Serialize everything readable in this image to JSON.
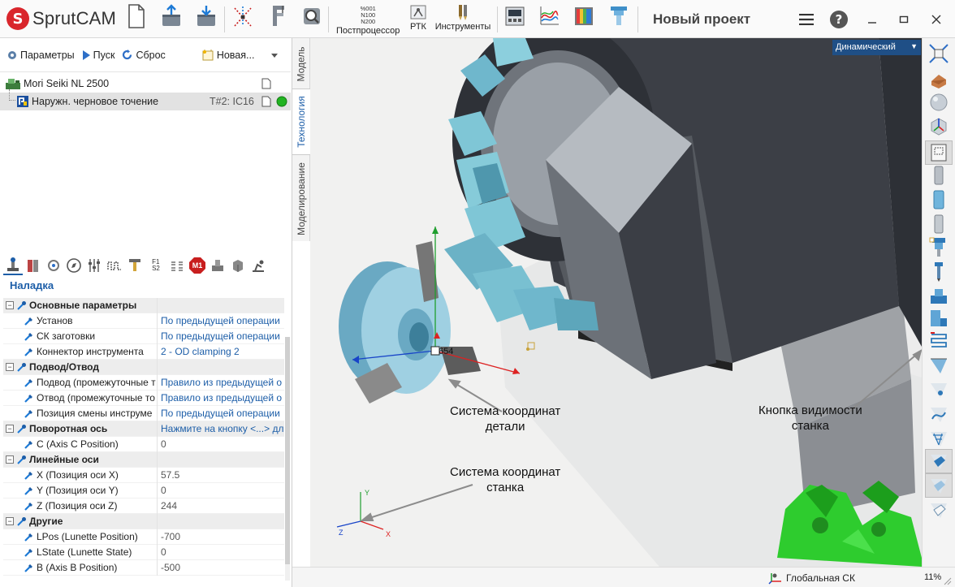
{
  "app": {
    "logo_letter": "S",
    "name": "SprutCAM",
    "project_title": "Новый проект"
  },
  "toolbar": {
    "postprocessor_label": "Постпроцессор",
    "rtk_label": "РТК",
    "tools_label": "Инструменты",
    "nc_codes": [
      "%001",
      "N100",
      "N200"
    ]
  },
  "left_toolbar": {
    "params_label": "Параметры",
    "run_label": "Пуск",
    "reset_label": "Сброс",
    "new_label": "Новая..."
  },
  "tree": {
    "machine": "Mori Seiki NL 2500",
    "operation": "Наружн. черновое точение",
    "operation_tool": "T#2: IC16"
  },
  "vertical_tabs": [
    "Модель",
    "Технология",
    "Моделирование"
  ],
  "setup": {
    "title": "Наладка",
    "m1_badge": "M1",
    "f1_label": "F1",
    "s2_label": "S2",
    "rows": [
      {
        "kind": "cat",
        "name": "Основные параметры",
        "value": ""
      },
      {
        "kind": "prop",
        "name": "Установ",
        "value": "По предыдущей операции",
        "link": true
      },
      {
        "kind": "prop",
        "name": "СК заготовки",
        "value": "По предыдущей операции",
        "link": true
      },
      {
        "kind": "prop",
        "name": "Коннектор инструмента",
        "value": "2 - OD clamping 2",
        "link": true
      },
      {
        "kind": "cat",
        "name": "Подвод/Отвод",
        "value": ""
      },
      {
        "kind": "prop",
        "name": "Подвод (промежуточные т",
        "value": "Правило из предыдущей о",
        "link": true
      },
      {
        "kind": "prop",
        "name": "Отвод (промежуточные то",
        "value": "Правило из предыдущей о",
        "link": true
      },
      {
        "kind": "prop",
        "name": "Позиция смены инструме",
        "value": "По предыдущей операции",
        "link": true
      },
      {
        "kind": "cat",
        "name": "Поворотная ось",
        "value": "Нажмите на кнопку <...> дл",
        "link": true
      },
      {
        "kind": "prop",
        "name": "C (Axis C Position)",
        "value": "0",
        "link": false
      },
      {
        "kind": "cat",
        "name": "Линейные оси",
        "value": ""
      },
      {
        "kind": "prop",
        "name": "X (Позиция оси X)",
        "value": "57.5",
        "link": false
      },
      {
        "kind": "prop",
        "name": "Y (Позиция оси Y)",
        "value": "0",
        "link": false
      },
      {
        "kind": "prop",
        "name": "Z (Позиция оси Z)",
        "value": "244",
        "link": false
      },
      {
        "kind": "cat",
        "name": "Другие",
        "value": ""
      },
      {
        "kind": "prop",
        "name": "LPos (Lunette Position)",
        "value": "-700",
        "link": false
      },
      {
        "kind": "prop",
        "name": "LState (Lunette State)",
        "value": "0",
        "link": false
      },
      {
        "kind": "prop",
        "name": "B (Axis B Position)",
        "value": "-500",
        "link": false
      }
    ]
  },
  "viewport": {
    "mode": "Динамический",
    "marker_value": "654",
    "axis_x": "X",
    "axis_y": "Y",
    "axis_z": "Z",
    "annotations": {
      "part_cs": "Система координат\nдетали",
      "machine_cs": "Система координат\nстанка",
      "machine_visibility": "Кнопка видимости\nстанка"
    }
  },
  "status": {
    "coordinate_system": "Глобальная СК",
    "zoom": "11%"
  },
  "colors": {
    "accent_blue": "#1d5ea8",
    "logo_red": "#d9262c",
    "machine_dark": "#3a3d44",
    "turret_teal": "#7fc6d6",
    "green_part": "#2ecc2e",
    "status_green": "#21b321"
  }
}
